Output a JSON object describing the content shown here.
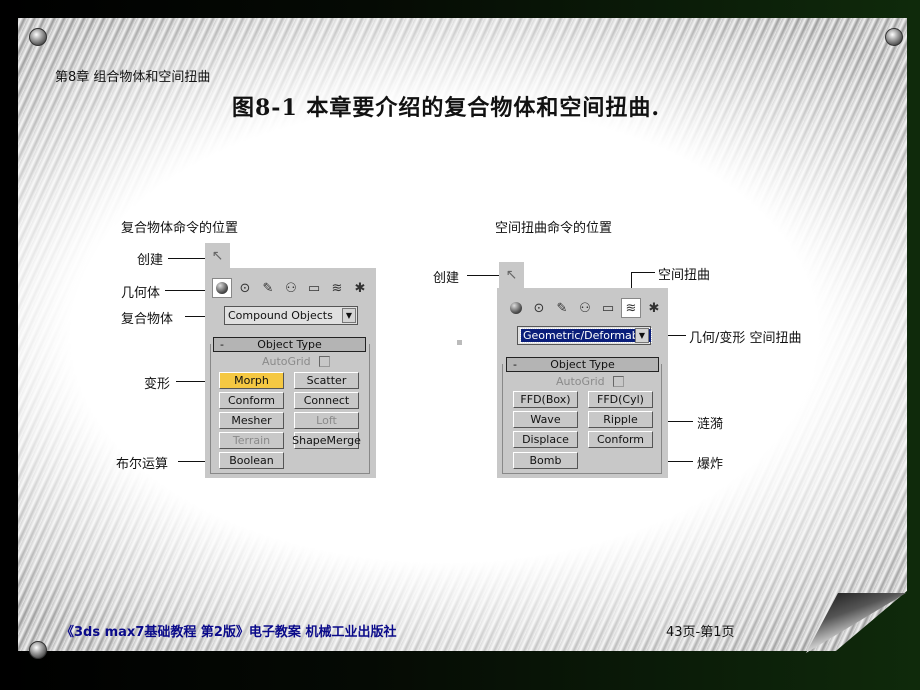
{
  "header": {
    "chapter": "第8章  组合物体和空间扭曲",
    "title": "图8-1 本章要介绍的复合物体和空间扭曲."
  },
  "left_figure": {
    "caption": "复合物体命令的位置",
    "callouts": {
      "create": "创建",
      "geometry": "几何体",
      "compound": "复合物体",
      "morph": "变形",
      "boolean": "布尔运算"
    },
    "toolbar_icons": [
      "geometry-sphere-icon",
      "shapes-icon",
      "lights-icon",
      "cameras-icon",
      "helpers-icon",
      "space-warps-icon",
      "systems-icon"
    ],
    "active_icon": "geometry-sphere-icon",
    "dropdown_value": "Compound Objects",
    "rollout_title": "Object Type",
    "rollout_toggle": "-",
    "autogrid_label": "AutoGrid",
    "buttons": [
      {
        "label": "Morph",
        "state": "active"
      },
      {
        "label": "Scatter",
        "state": "normal"
      },
      {
        "label": "Conform",
        "state": "normal"
      },
      {
        "label": "Connect",
        "state": "normal"
      },
      {
        "label": "Mesher",
        "state": "normal"
      },
      {
        "label": "Loft",
        "state": "disabled"
      },
      {
        "label": "Terrain",
        "state": "disabled"
      },
      {
        "label": "ShapeMerge",
        "state": "normal"
      },
      {
        "label": "Boolean",
        "state": "normal"
      }
    ]
  },
  "right_figure": {
    "caption": "空间扭曲命令的位置",
    "callouts": {
      "create": "创建",
      "space_warps": "空间扭曲",
      "geometric_deformable": "几何/变形  空间扭曲",
      "ripple": "涟漪",
      "bomb": "爆炸"
    },
    "toolbar_icons": [
      "geometry-sphere-icon",
      "shapes-icon",
      "lights-icon",
      "cameras-icon",
      "helpers-icon",
      "space-warps-icon",
      "systems-icon"
    ],
    "active_icon": "space-warps-icon",
    "dropdown_value": "Geometric/Deformable",
    "rollout_title": "Object Type",
    "rollout_toggle": "-",
    "autogrid_label": "AutoGrid",
    "buttons": [
      {
        "label": "FFD(Box)",
        "state": "normal"
      },
      {
        "label": "FFD(Cyl)",
        "state": "normal"
      },
      {
        "label": "Wave",
        "state": "normal"
      },
      {
        "label": "Ripple",
        "state": "normal"
      },
      {
        "label": "Displace",
        "state": "normal"
      },
      {
        "label": "Conform",
        "state": "normal"
      },
      {
        "label": "Bomb",
        "state": "normal"
      }
    ]
  },
  "footer": {
    "book": "《3ds max7基础教程 第2版》电子教案 机械工业出版社",
    "page": "43页-第1页"
  },
  "colors": {
    "footer_text": "#0a0a8a",
    "active_button": "#f5c842",
    "dropdown_highlight": "#0a1e7a",
    "panel_bg": "#c8c8c8"
  }
}
